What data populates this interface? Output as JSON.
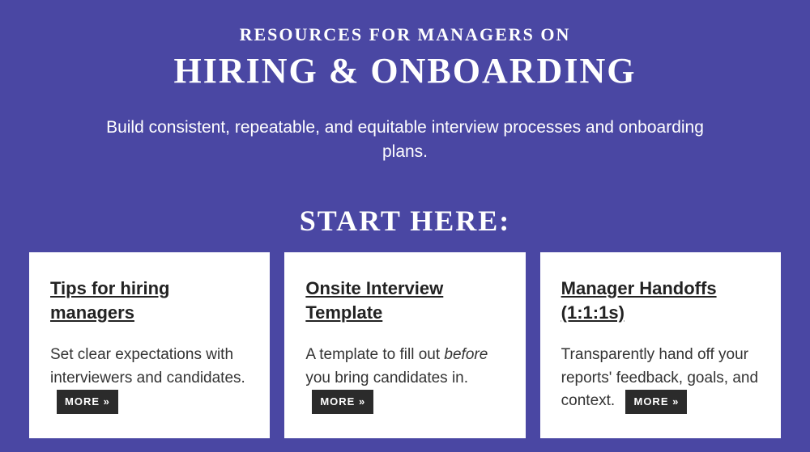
{
  "header": {
    "eyebrow": "RESOURCES FOR MANAGERS ON",
    "title": "HIRING & ONBOARDING",
    "subtitle": "Build consistent, repeatable, and equitable interview processes and onboarding plans."
  },
  "section_label": "START HERE:",
  "more_label": "MORE »",
  "cards": [
    {
      "title": "Tips for hiring managers",
      "body_pre": "Set clear expectations with interviewers and candidates.",
      "body_em": "",
      "body_post": ""
    },
    {
      "title": "Onsite Interview Template",
      "body_pre": "A template to fill out ",
      "body_em": "before",
      "body_post": " you bring candidates in."
    },
    {
      "title": "Manager Handoffs (1:1:1s)",
      "body_pre": "Transparently hand off your reports' feedback, goals, and context.",
      "body_em": "",
      "body_post": ""
    }
  ]
}
